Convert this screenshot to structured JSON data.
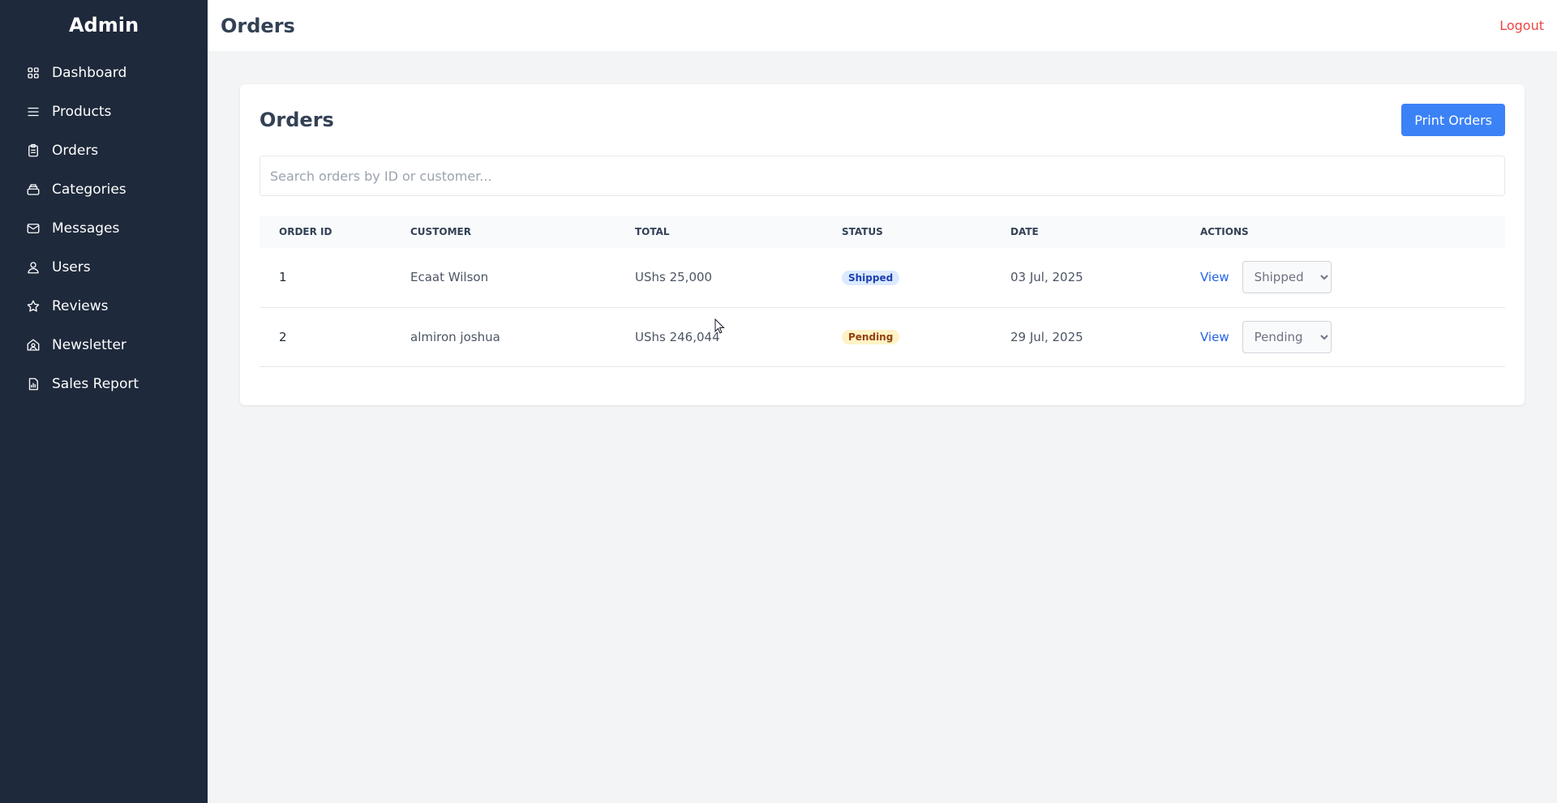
{
  "sidebar": {
    "brand": "Admin",
    "items": [
      {
        "label": "Dashboard",
        "icon": "grid-icon"
      },
      {
        "label": "Products",
        "icon": "menu-icon"
      },
      {
        "label": "Orders",
        "icon": "clipboard-icon"
      },
      {
        "label": "Categories",
        "icon": "box-icon"
      },
      {
        "label": "Messages",
        "icon": "mail-icon"
      },
      {
        "label": "Users",
        "icon": "user-icon"
      },
      {
        "label": "Reviews",
        "icon": "star-icon"
      },
      {
        "label": "Newsletter",
        "icon": "newsletter-icon"
      },
      {
        "label": "Sales Report",
        "icon": "report-icon"
      }
    ]
  },
  "header": {
    "title": "Orders",
    "logout_label": "Logout"
  },
  "main": {
    "title": "Orders",
    "print_label": "Print Orders",
    "search_placeholder": "Search orders by ID or customer...",
    "table": {
      "columns": [
        "Order ID",
        "Customer",
        "Total",
        "Status",
        "Date",
        "Actions"
      ],
      "rows": [
        {
          "id": "1",
          "customer": "Ecaat Wilson",
          "total": "UShs 25,000",
          "status": "Shipped",
          "date": "03 Jul, 2025",
          "view": "View",
          "select_value": "Shipped"
        },
        {
          "id": "2",
          "customer": "almiron joshua",
          "total": "UShs 246,044",
          "status": "Pending",
          "date": "29 Jul, 2025",
          "view": "View",
          "select_value": "Pending"
        }
      ],
      "status_options": [
        "Pending",
        "Shipped"
      ]
    }
  },
  "colors": {
    "sidebar_bg": "#1e293b",
    "accent": "#3b82f6",
    "logout": "#ef4444",
    "shipped_badge": "#dbeafe",
    "pending_badge": "#fef3c7"
  }
}
